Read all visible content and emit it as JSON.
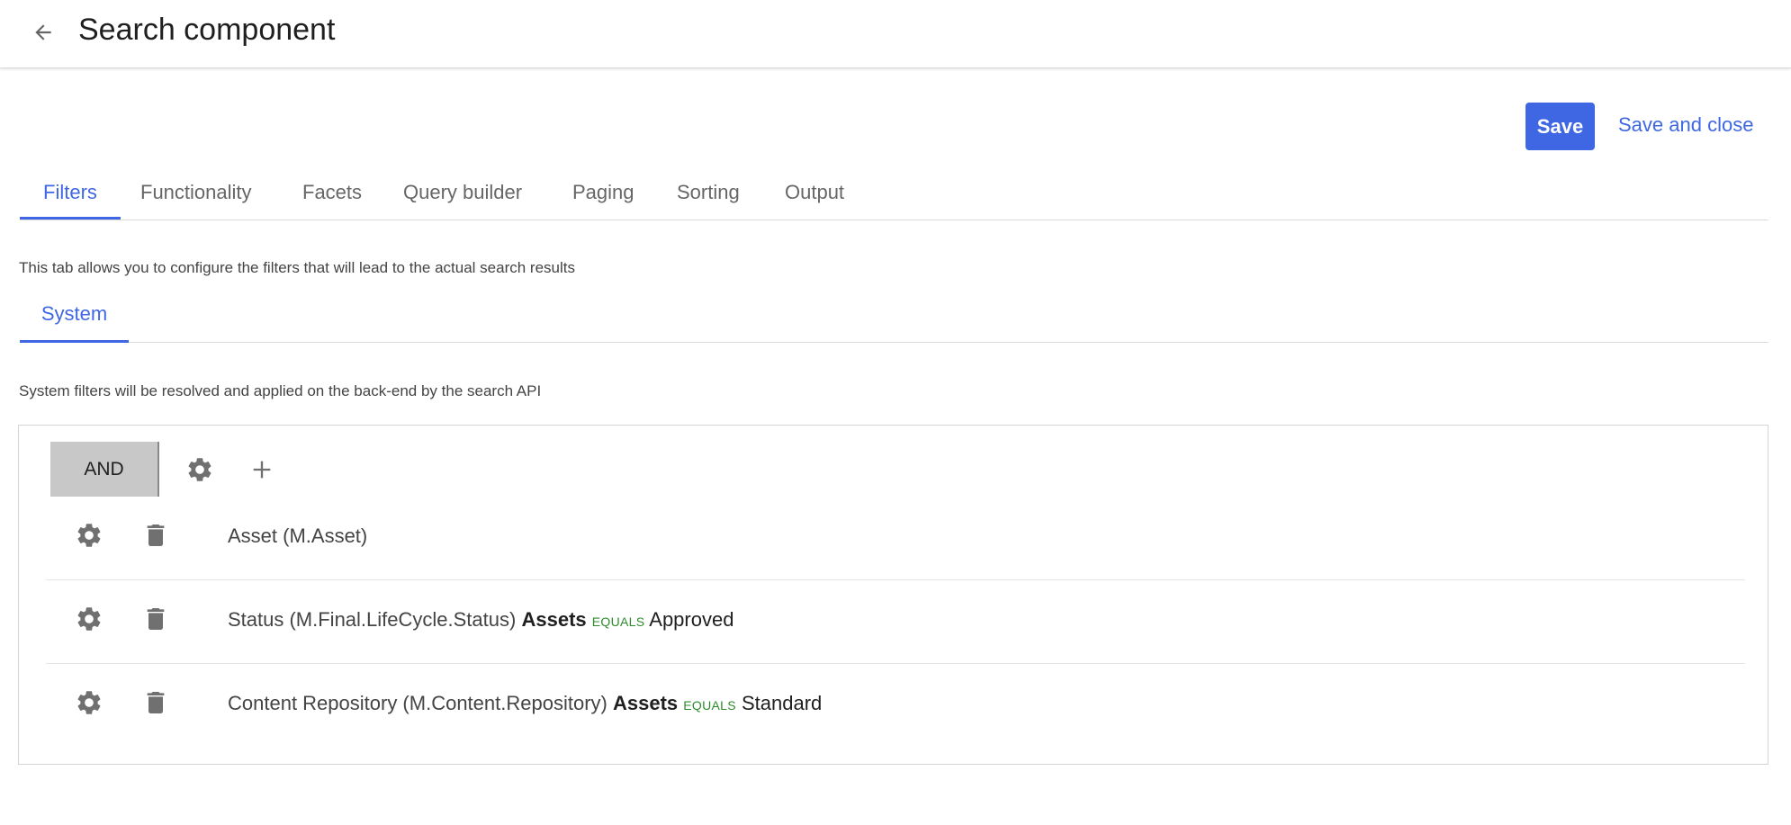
{
  "header": {
    "title": "Search component",
    "back_icon": "arrow-left-icon"
  },
  "actions": {
    "save_label": "Save",
    "save_close_label": "Save and close"
  },
  "tabs": [
    {
      "label": "Filters",
      "active": true
    },
    {
      "label": "Functionality",
      "active": false
    },
    {
      "label": "Facets",
      "active": false
    },
    {
      "label": "Query builder",
      "active": false
    },
    {
      "label": "Paging",
      "active": false
    },
    {
      "label": "Sorting",
      "active": false
    },
    {
      "label": "Output",
      "active": false
    }
  ],
  "filters_description": "This tab allows you to configure the filters that will lead to the actual search results",
  "subtabs": [
    {
      "label": "System",
      "active": true
    }
  ],
  "system_description": "System filters will be resolved and applied on the back-end by the search API",
  "group": {
    "operator_label": "AND",
    "settings_icon": "gear-icon",
    "add_icon": "plus-icon"
  },
  "rows": [
    {
      "field": "Asset (M.Asset)",
      "scope": "",
      "operator": "",
      "value": ""
    },
    {
      "field": "Status (M.Final.LifeCycle.Status)",
      "scope": "Assets",
      "operator": "EQUALS",
      "value": "Approved"
    },
    {
      "field": "Content Repository (M.Content.Repository)",
      "scope": "Assets",
      "operator": "EQUALS",
      "value": "Standard"
    }
  ],
  "colors": {
    "accent": "#3f67e3",
    "operator_green": "#2e8b2e",
    "and_button_bg": "#c8c8c8"
  }
}
